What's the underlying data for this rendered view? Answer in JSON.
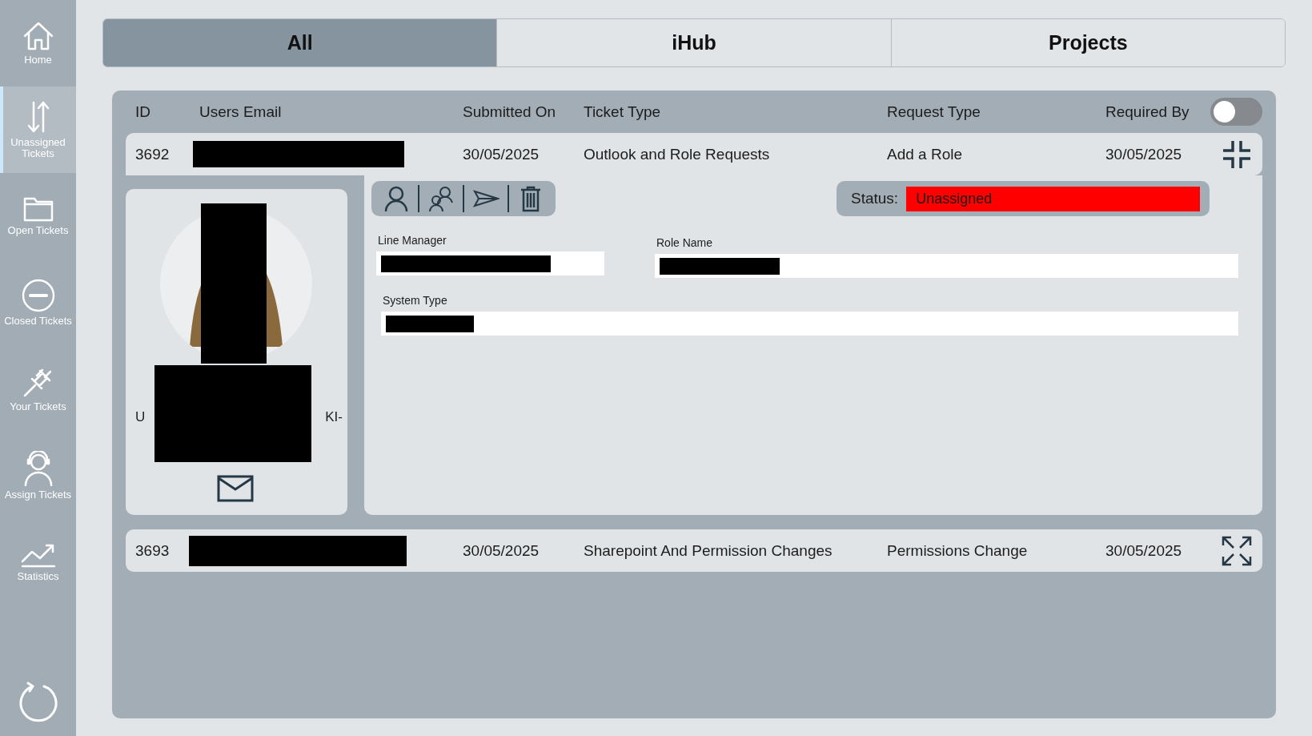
{
  "sidebar": {
    "items": [
      {
        "label": "Home",
        "selected": false
      },
      {
        "label": "Unassigned Tickets",
        "selected": true
      },
      {
        "label": "Open Tickets",
        "selected": false
      },
      {
        "label": "Closed Tickets",
        "selected": false
      },
      {
        "label": "Your Tickets",
        "selected": false
      },
      {
        "label": "Assign Tickets",
        "selected": false
      },
      {
        "label": "Statistics",
        "selected": false
      }
    ]
  },
  "tabs": [
    {
      "label": "All",
      "selected": true
    },
    {
      "label": "iHub",
      "selected": false
    },
    {
      "label": "Projects",
      "selected": false
    }
  ],
  "table": {
    "columns": [
      "ID",
      "Users Email",
      "Submitted On",
      "Ticket Type",
      "Request Type",
      "Required By"
    ],
    "toggle": {
      "on": false
    },
    "rows": [
      {
        "id": "3692",
        "submitted_on": "30/05/2025",
        "ticket_type": "Outlook and Role Requests",
        "request_type": "Add a Role",
        "required_by": "30/05/2025",
        "expanded": true
      },
      {
        "id": "3693",
        "submitted_on": "30/05/2025",
        "ticket_type": "Sharepoint And Permission Changes",
        "request_type": "Permissions Change",
        "required_by": "30/05/2025",
        "expanded": false
      }
    ]
  },
  "detail": {
    "profile": {
      "name_start": "U",
      "name_end": "KI-"
    },
    "status": {
      "label": "Status:",
      "value": "Unassigned",
      "color": "#ff0000"
    },
    "fields": [
      {
        "label": "Line Manager",
        "kind": "short"
      },
      {
        "label": "Role Name",
        "kind": "long"
      },
      {
        "label": "System Type",
        "kind": "full"
      }
    ]
  }
}
